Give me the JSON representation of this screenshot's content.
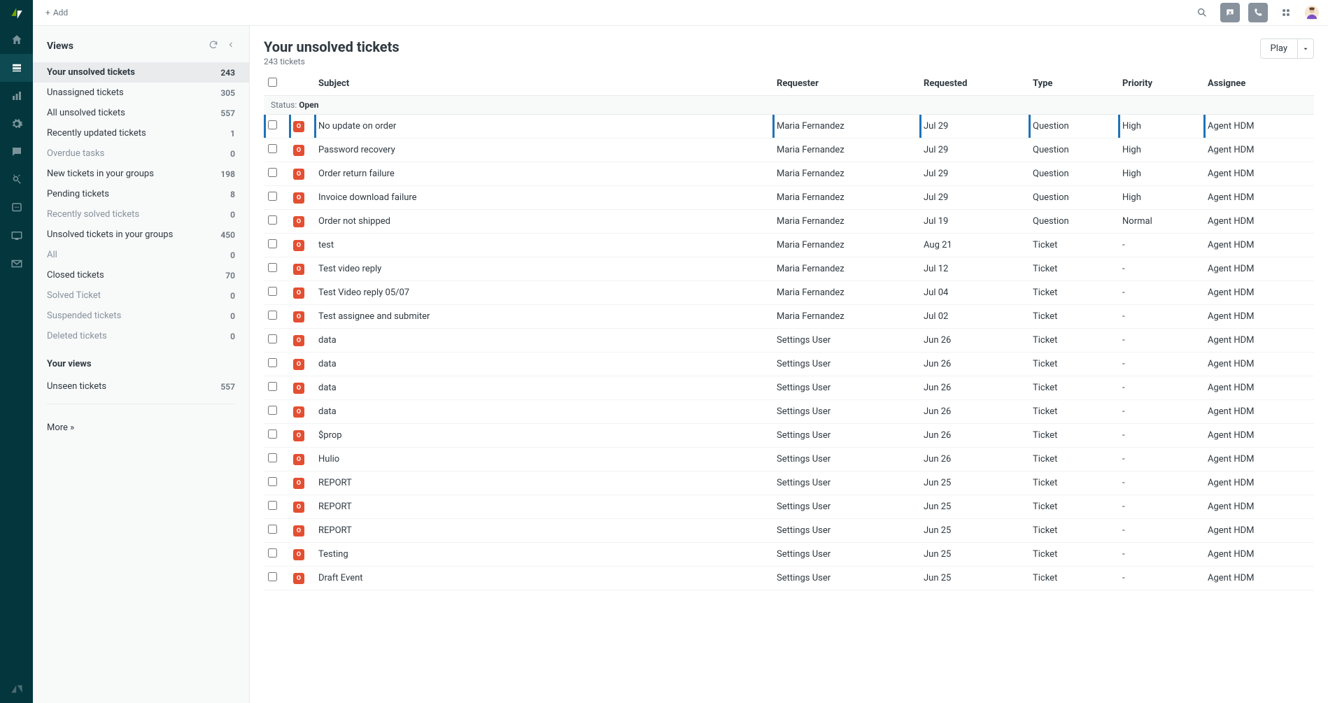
{
  "header": {
    "add_label": "Add"
  },
  "sidebar": {
    "title": "Views",
    "items": [
      {
        "label": "Your unsolved tickets",
        "count": "243",
        "active": true
      },
      {
        "label": "Unassigned tickets",
        "count": "305"
      },
      {
        "label": "All unsolved tickets",
        "count": "557"
      },
      {
        "label": "Recently updated tickets",
        "count": "1"
      },
      {
        "label": "Overdue tasks",
        "count": "0",
        "dim": true
      },
      {
        "label": "New tickets in your groups",
        "count": "198"
      },
      {
        "label": "Pending tickets",
        "count": "8"
      },
      {
        "label": "Recently solved tickets",
        "count": "0",
        "dim": true
      },
      {
        "label": "Unsolved tickets in your groups",
        "count": "450"
      },
      {
        "label": "All",
        "count": "0",
        "dim": true
      },
      {
        "label": "Closed tickets",
        "count": "70"
      },
      {
        "label": "Solved Ticket",
        "count": "0",
        "dim": true
      },
      {
        "label": "Suspended tickets",
        "count": "0",
        "dim": true
      },
      {
        "label": "Deleted tickets",
        "count": "0",
        "dim": true
      }
    ],
    "your_views_label": "Your views",
    "your_views": [
      {
        "label": "Unseen tickets",
        "count": "557"
      }
    ],
    "more_label": "More »"
  },
  "tickets": {
    "title": "Your unsolved tickets",
    "subtitle": "243 tickets",
    "play_label": "Play",
    "columns": {
      "subject": "Subject",
      "requester": "Requester",
      "requested": "Requested",
      "type": "Type",
      "priority": "Priority",
      "assignee": "Assignee"
    },
    "group_label": "Status:",
    "group_value": "Open",
    "status_badge": "O",
    "rows": [
      {
        "subject": "No update on order",
        "requester": "Maria Fernandez",
        "requested": "Jul 29",
        "type": "Question",
        "priority": "High",
        "assignee": "Agent HDM",
        "hl": true
      },
      {
        "subject": "Password recovery",
        "requester": "Maria Fernandez",
        "requested": "Jul 29",
        "type": "Question",
        "priority": "High",
        "assignee": "Agent HDM"
      },
      {
        "subject": "Order return failure",
        "requester": "Maria Fernandez",
        "requested": "Jul 29",
        "type": "Question",
        "priority": "High",
        "assignee": "Agent HDM"
      },
      {
        "subject": "Invoice download failure",
        "requester": "Maria Fernandez",
        "requested": "Jul 29",
        "type": "Question",
        "priority": "High",
        "assignee": "Agent HDM"
      },
      {
        "subject": "Order not shipped",
        "requester": "Maria Fernandez",
        "requested": "Jul 19",
        "type": "Question",
        "priority": "Normal",
        "assignee": "Agent HDM"
      },
      {
        "subject": "test",
        "requester": "Maria Fernandez",
        "requested": "Aug 21",
        "type": "Ticket",
        "priority": "-",
        "assignee": "Agent HDM"
      },
      {
        "subject": "Test video reply",
        "requester": "Maria Fernandez",
        "requested": "Jul 12",
        "type": "Ticket",
        "priority": "-",
        "assignee": "Agent HDM"
      },
      {
        "subject": "Test Video reply 05/07",
        "requester": "Maria Fernandez",
        "requested": "Jul 04",
        "type": "Ticket",
        "priority": "-",
        "assignee": "Agent HDM"
      },
      {
        "subject": "Test assignee and submiter",
        "requester": "Maria Fernandez",
        "requested": "Jul 02",
        "type": "Ticket",
        "priority": "-",
        "assignee": "Agent HDM"
      },
      {
        "subject": "data",
        "requester": "Settings User",
        "requested": "Jun 26",
        "type": "Ticket",
        "priority": "-",
        "assignee": "Agent HDM"
      },
      {
        "subject": "data",
        "requester": "Settings User",
        "requested": "Jun 26",
        "type": "Ticket",
        "priority": "-",
        "assignee": "Agent HDM"
      },
      {
        "subject": "data",
        "requester": "Settings User",
        "requested": "Jun 26",
        "type": "Ticket",
        "priority": "-",
        "assignee": "Agent HDM"
      },
      {
        "subject": "data",
        "requester": "Settings User",
        "requested": "Jun 26",
        "type": "Ticket",
        "priority": "-",
        "assignee": "Agent HDM"
      },
      {
        "subject": "$prop",
        "requester": "Settings User",
        "requested": "Jun 26",
        "type": "Ticket",
        "priority": "-",
        "assignee": "Agent HDM"
      },
      {
        "subject": "Hulio",
        "requester": "Settings User",
        "requested": "Jun 26",
        "type": "Ticket",
        "priority": "-",
        "assignee": "Agent HDM"
      },
      {
        "subject": "REPORT",
        "requester": "Settings User",
        "requested": "Jun 25",
        "type": "Ticket",
        "priority": "-",
        "assignee": "Agent HDM"
      },
      {
        "subject": "REPORT",
        "requester": "Settings User",
        "requested": "Jun 25",
        "type": "Ticket",
        "priority": "-",
        "assignee": "Agent HDM"
      },
      {
        "subject": "REPORT",
        "requester": "Settings User",
        "requested": "Jun 25",
        "type": "Ticket",
        "priority": "-",
        "assignee": "Agent HDM"
      },
      {
        "subject": "Testing",
        "requester": "Settings User",
        "requested": "Jun 25",
        "type": "Ticket",
        "priority": "-",
        "assignee": "Agent HDM"
      },
      {
        "subject": "Draft Event",
        "requester": "Settings User",
        "requested": "Jun 25",
        "type": "Ticket",
        "priority": "-",
        "assignee": "Agent HDM"
      }
    ]
  }
}
